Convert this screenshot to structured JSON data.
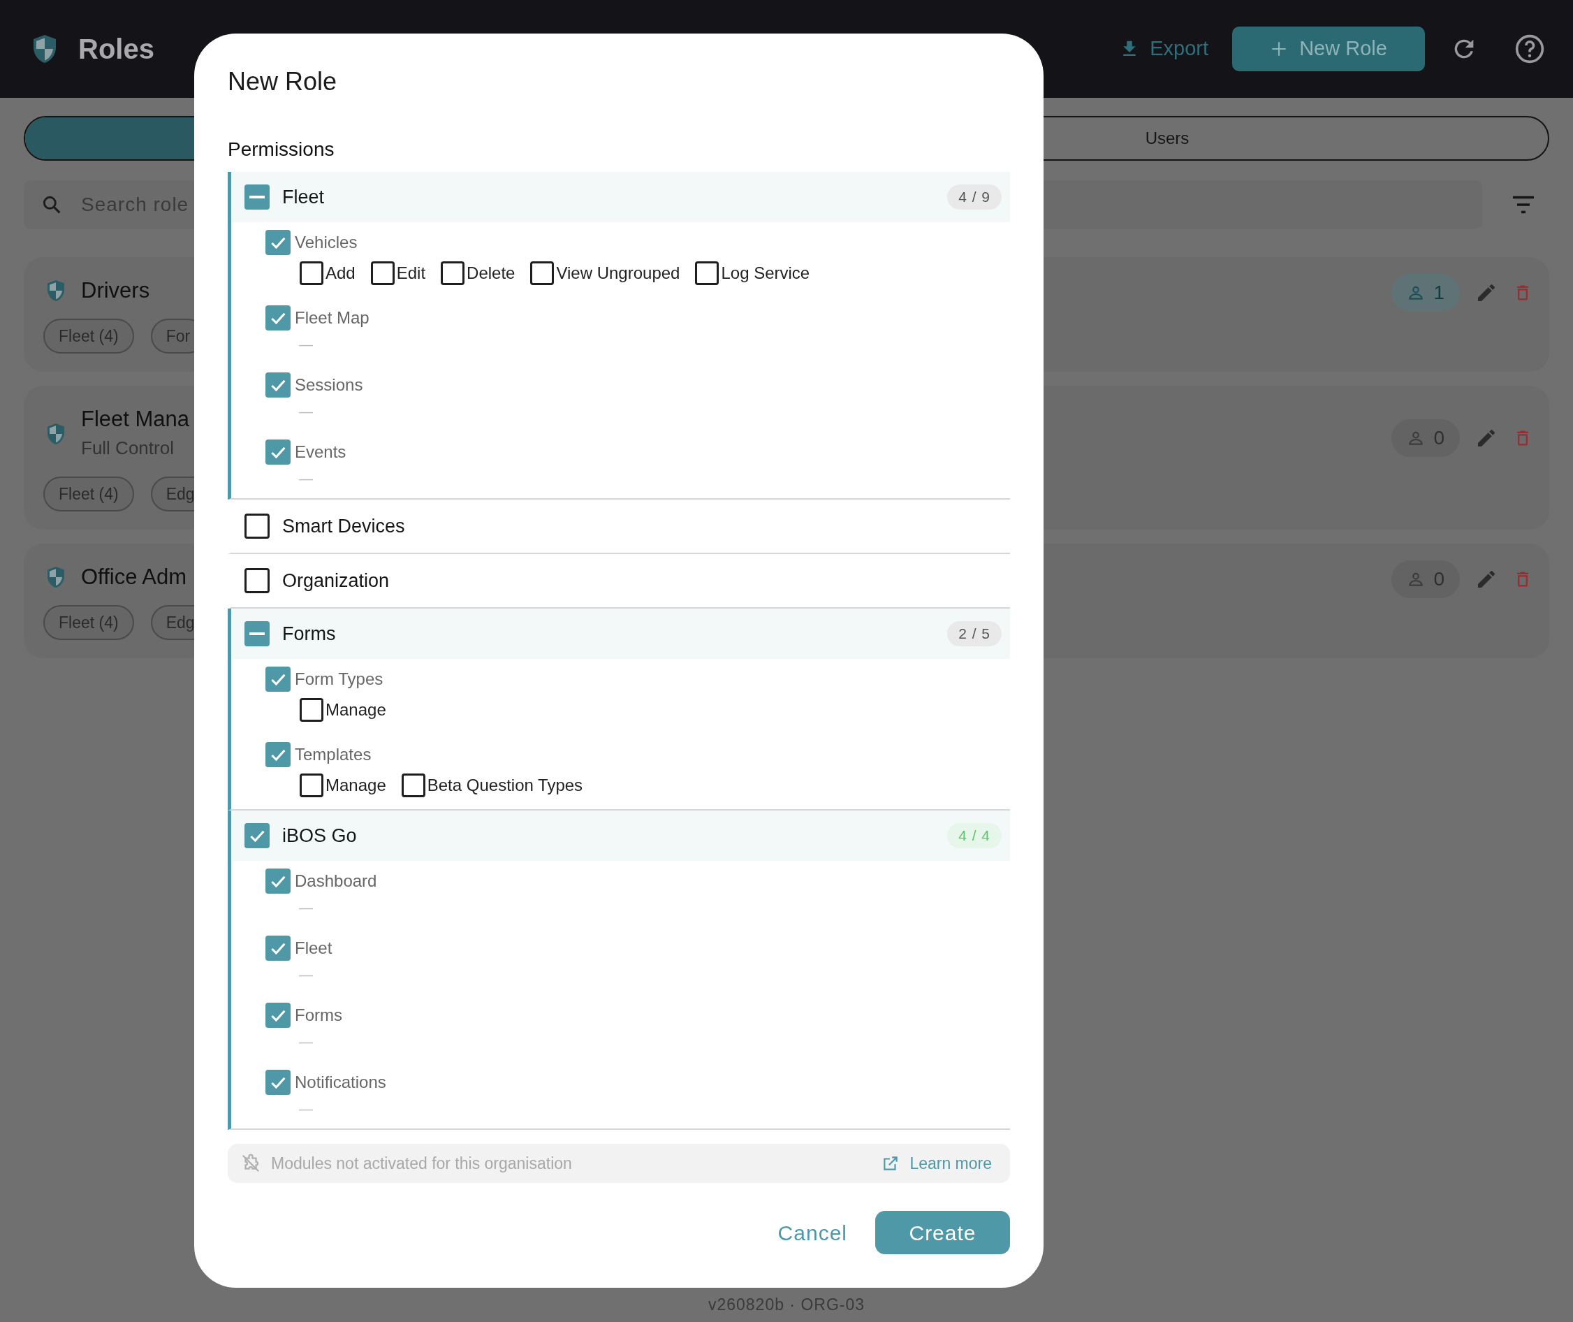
{
  "header": {
    "title": "Roles",
    "export": "Export",
    "new_role": "New Role"
  },
  "tabs": [
    {
      "selected": true
    },
    {
      "label": "Users",
      "selected": false
    }
  ],
  "search": {
    "placeholder": "Search role"
  },
  "roles": [
    {
      "name": "Drivers",
      "tags": [
        "Fleet (4)",
        "For"
      ],
      "users": "1",
      "highlighted": true
    },
    {
      "name": "Fleet Mana",
      "description": "Full Control",
      "tags": [
        "Fleet (4)",
        "Edg"
      ],
      "users": "0",
      "highlighted": false
    },
    {
      "name": "Office Adm",
      "tags": [
        "Fleet (4)",
        "Edg"
      ],
      "users": "0",
      "highlighted": false
    }
  ],
  "dialog": {
    "title": "New Role",
    "section": "Permissions",
    "modules": [
      {
        "name": "Fleet",
        "checked": false,
        "indeterminate": true,
        "count": "4 / 9",
        "expanded": true,
        "permissions": [
          {
            "label": "Vehicles",
            "checked": true,
            "actions": [
              {
                "label": "Add",
                "checked": false
              },
              {
                "label": "Edit",
                "checked": false
              },
              {
                "label": "Delete",
                "checked": false
              },
              {
                "label": "View Ungrouped",
                "checked": false
              },
              {
                "label": "Log Service",
                "checked": false
              }
            ]
          },
          {
            "label": "Fleet Map",
            "checked": true,
            "note": "—"
          },
          {
            "label": "Sessions",
            "checked": true,
            "note": "—"
          },
          {
            "label": "Events",
            "checked": true,
            "note": "—"
          }
        ]
      },
      {
        "name": "Smart Devices",
        "checked": false,
        "indeterminate": false,
        "expanded": false
      },
      {
        "name": "Organization",
        "checked": false,
        "indeterminate": false,
        "expanded": false
      },
      {
        "name": "Forms",
        "checked": false,
        "indeterminate": true,
        "count": "2 / 5",
        "expanded": true,
        "permissions": [
          {
            "label": "Form Types",
            "checked": true,
            "actions": [
              {
                "label": "Manage",
                "checked": false
              }
            ]
          },
          {
            "label": "Templates",
            "checked": true,
            "actions": [
              {
                "label": "Manage",
                "checked": false
              },
              {
                "label": "Beta Question Types",
                "checked": false
              }
            ]
          }
        ]
      },
      {
        "name": "iBOS Go",
        "checked": true,
        "indeterminate": false,
        "count": "4 / 4",
        "expanded": true,
        "permissions": [
          {
            "label": "Dashboard",
            "checked": true,
            "note": "—"
          },
          {
            "label": "Fleet",
            "checked": true,
            "note": "—"
          },
          {
            "label": "Forms",
            "checked": true,
            "note": "—"
          },
          {
            "label": "Notifications",
            "checked": true,
            "note": "—"
          }
        ]
      }
    ],
    "notice": "Modules not activated for this organisation",
    "learn_more": "Learn more",
    "cancel": "Cancel",
    "create": "Create"
  },
  "version": "v260820b · ORG-03"
}
